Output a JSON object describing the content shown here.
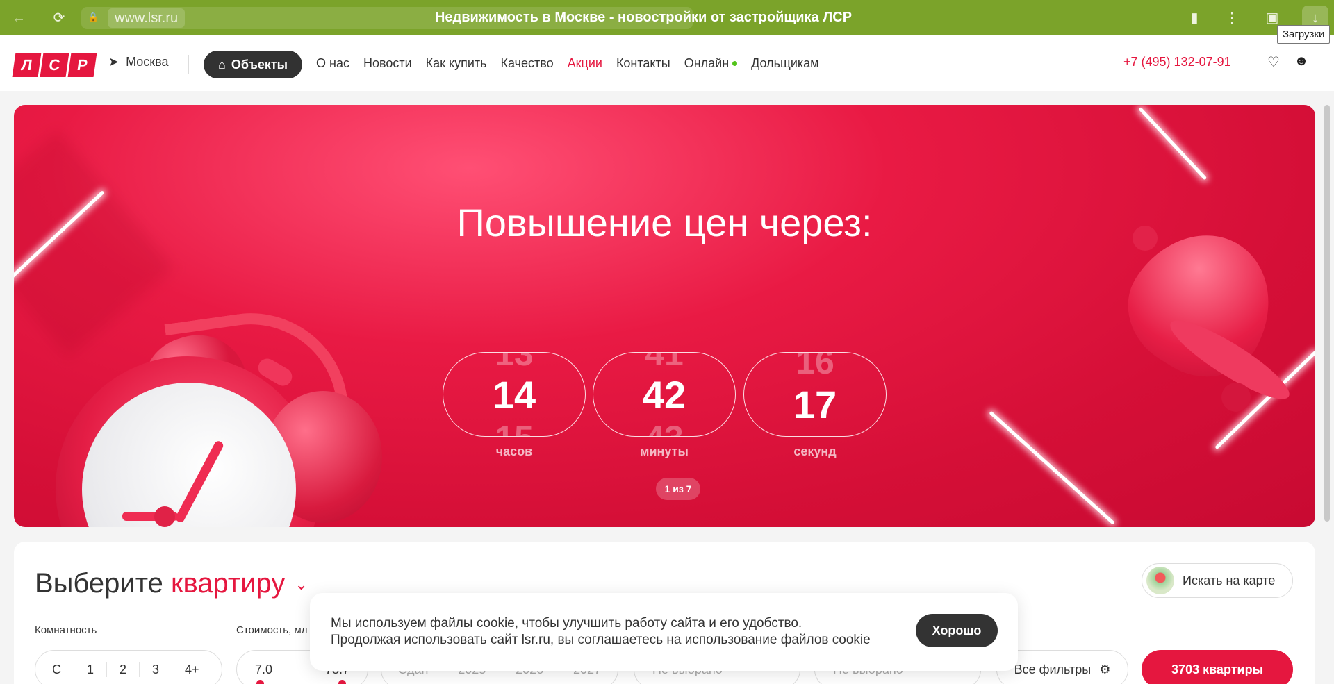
{
  "browser": {
    "url": "www.lsr.ru",
    "title": "Недвижимость в Москве - новостройки от застройщика ЛСР",
    "tooltip": "Загрузки",
    "accent_color": "#7ba32a"
  },
  "header": {
    "logo_letters": [
      "Л",
      "С",
      "Р"
    ],
    "city": "Москва",
    "objects_label": "Объекты",
    "nav": [
      {
        "label": "О нас"
      },
      {
        "label": "Новости"
      },
      {
        "label": "Как купить"
      },
      {
        "label": "Качество"
      },
      {
        "label": "Акции"
      },
      {
        "label": "Контакты"
      },
      {
        "label": "Онлайн"
      },
      {
        "label": "Дольщикам"
      }
    ],
    "phone": "+7 (495) 132-07-91",
    "brand_color": "#e5173f"
  },
  "hero": {
    "title": "Повышение цен через:",
    "timers": [
      {
        "prev": "13",
        "value": "14",
        "next": "15",
        "label": "часов"
      },
      {
        "prev": "41",
        "value": "42",
        "next": "43",
        "label": "минуты"
      },
      {
        "prev": "16",
        "value": "17",
        "next": "",
        "label": "секунд"
      }
    ],
    "pager": "1 из 7"
  },
  "search": {
    "title_prefix": "Выберите",
    "title_accent": "квартиру",
    "map_button": "Искать на карте",
    "rooms_label": "Комнатность",
    "rooms": [
      "С",
      "1",
      "2",
      "3",
      "4+"
    ],
    "price_label": "Стоимость, мл",
    "price_min": "7.0",
    "price_max": "78.7",
    "deadline": [
      "Сдан",
      "2025",
      "2026",
      "2027"
    ],
    "select_placeholder_1": "Не выбрано",
    "select_placeholder_2": "Не выбрано",
    "all_filters": "Все фильтры",
    "results_button": "3703 квартиры"
  },
  "cookie": {
    "line1": "Мы используем файлы cookie, чтобы улучшить работу сайта и его удобство.",
    "line2": "Продолжая использовать сайт lsr.ru, вы соглашаетесь на использование файлов cookie",
    "button": "Хорошо"
  }
}
